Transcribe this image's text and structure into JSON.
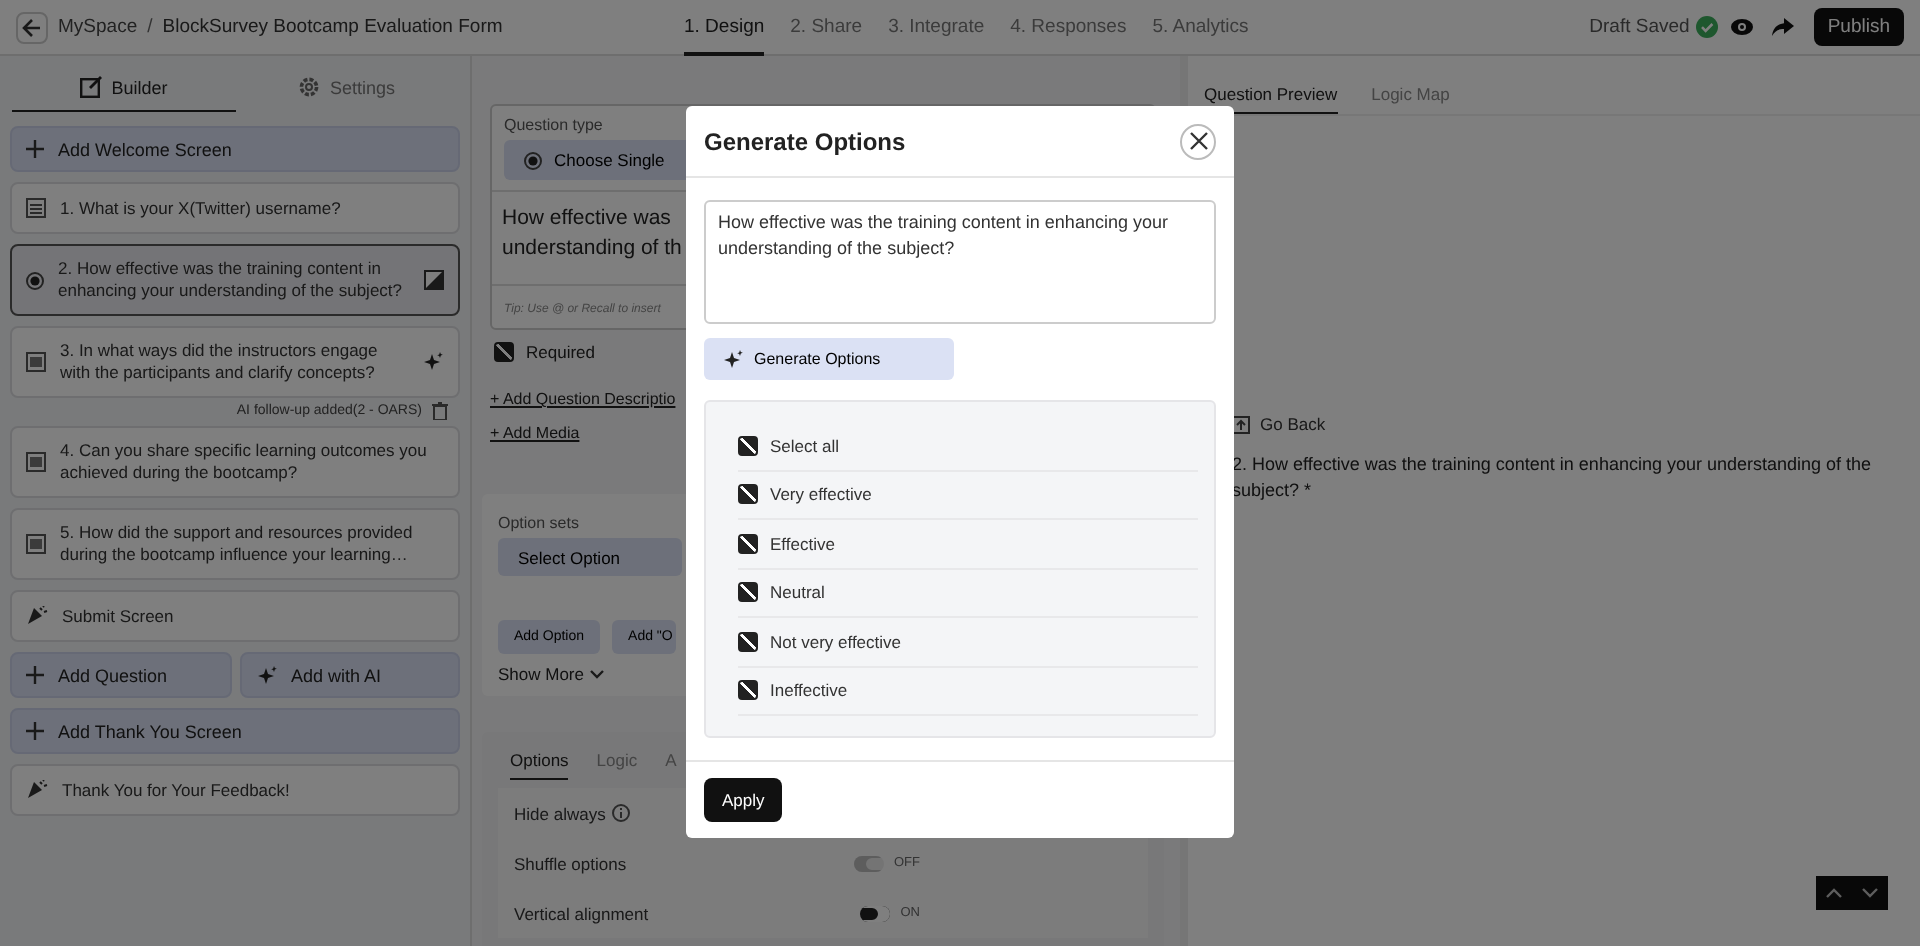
{
  "topbar": {
    "breadcrumb": [
      "MySpace",
      "BlockSurvey Bootcamp Evaluation Form"
    ],
    "separator": "/",
    "steps": [
      {
        "label": "1. Design",
        "selected": true
      },
      {
        "label": "2. Share",
        "selected": false
      },
      {
        "label": "3. Integrate",
        "selected": false
      },
      {
        "label": "4. Responses",
        "selected": false
      },
      {
        "label": "5. Analytics",
        "selected": false
      }
    ],
    "status": "Draft Saved",
    "publish": "Publish"
  },
  "sidebar": {
    "tabs": [
      {
        "label": "Builder",
        "selected": true
      },
      {
        "label": "Settings",
        "selected": false
      }
    ],
    "items": [
      {
        "kind": "add",
        "label": "Add Welcome Screen"
      },
      {
        "kind": "short_text",
        "label": "1. What is your X(Twitter) username?",
        "selected": false
      },
      {
        "kind": "single_choice",
        "label": "2. How effective was the training content in enhancing your understanding of the subject?",
        "selected": true
      },
      {
        "kind": "long_text",
        "label": "3. In what ways did the instructors engage with the participants and clarify concepts?",
        "selected": false,
        "ai": true
      },
      {
        "kind": "followup",
        "label": "AI follow-up added(2 - OARS)"
      },
      {
        "kind": "long_text",
        "label": "4. Can you share specific learning outcomes you achieved during the bootcamp?",
        "selected": false
      },
      {
        "kind": "long_text",
        "label": "5. How did the support and resources provided during the bootcamp influence your learning…",
        "selected": false
      },
      {
        "kind": "screen",
        "label": "Submit Screen"
      },
      {
        "kind": "pair",
        "labels": [
          "Add Question",
          "Add with AI"
        ]
      },
      {
        "kind": "add",
        "label": "Add Thank You Screen"
      },
      {
        "kind": "screen",
        "label": "Thank You for Your Feedback!"
      }
    ]
  },
  "editor": {
    "type_label": "Question type",
    "type_value": "Choose Single",
    "question_lines": [
      "How effective was",
      "understanding of th"
    ],
    "tip": "Tip: Use @ or Recall to insert",
    "required": {
      "label": "Required",
      "checked": true
    },
    "links": [
      "+ Add Question Descriptio",
      "+ Add Media"
    ],
    "option_sets_label": "Option sets",
    "option_sets_value": "Select Option",
    "option_buttons": [
      "Add Option",
      "Add \"O"
    ],
    "show_more": "Show More",
    "tabs": [
      {
        "label": "Options",
        "selected": true
      },
      {
        "label": "Logic",
        "selected": false
      },
      {
        "label": "A",
        "selected": false
      }
    ],
    "settings": [
      {
        "kind": "info",
        "label": "Hide always"
      },
      {
        "kind": "toggle",
        "label": "Shuffle options",
        "on": false,
        "state_label": "OFF"
      },
      {
        "kind": "toggle",
        "label": "Vertical alignment",
        "on": true,
        "state_label": "ON"
      }
    ]
  },
  "preview": {
    "tabs": [
      {
        "label": "Question Preview",
        "selected": true
      },
      {
        "label": "Logic Map",
        "selected": false
      }
    ],
    "go_back": "Go Back",
    "question": "2. How effective was the training content in enhancing your understanding of the subject? *"
  },
  "modal": {
    "title": "Generate Options",
    "question": "How effective was the training content in enhancing your understanding of the subject?",
    "generate": "Generate Options",
    "options": [
      {
        "label": "Select all",
        "checked": true
      },
      {
        "label": "Very effective",
        "checked": true
      },
      {
        "label": "Effective",
        "checked": true
      },
      {
        "label": "Neutral",
        "checked": true
      },
      {
        "label": "Not very effective",
        "checked": true
      },
      {
        "label": "Ineffective",
        "checked": true
      }
    ],
    "apply": "Apply"
  }
}
